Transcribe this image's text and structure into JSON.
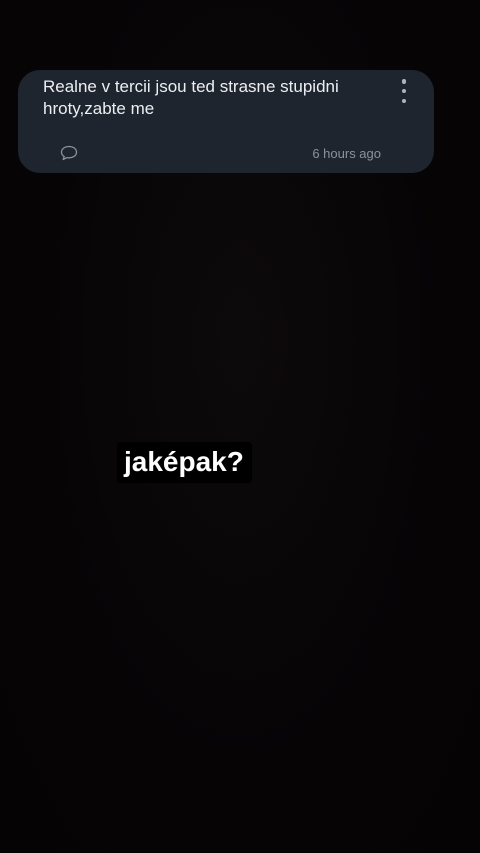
{
  "message_card": {
    "text": "Realne v tercii jsou ted strasne stupidni hroty,zabte me",
    "timestamp": "6 hours ago",
    "reply_icon": "speech-bubble-icon",
    "more_icon": "more-vertical-icon"
  },
  "caption": {
    "text": "jaképak?"
  },
  "colors": {
    "background": "#060405",
    "card": "#1f252e",
    "card_text": "#eceef2",
    "muted_text": "#8b929c",
    "caption_bg": "#000000",
    "caption_text": "#ffffff"
  }
}
